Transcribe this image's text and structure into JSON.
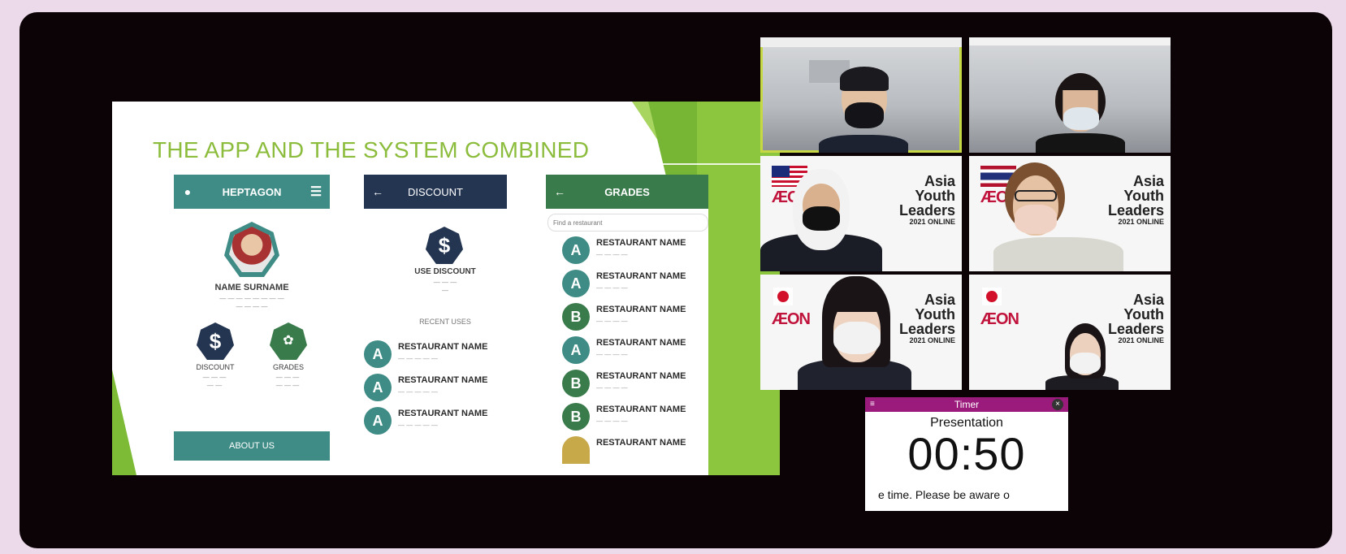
{
  "slide": {
    "title": "THE APP AND THE SYSTEM COMBINED",
    "col1": {
      "header": "HEPTAGON",
      "profile_name": "NAME SURNAME",
      "tile_discount": "DISCOUNT",
      "tile_grades": "GRADES",
      "about_button": "ABOUT US"
    },
    "col2": {
      "header": "DISCOUNT",
      "use_discount": "USE DISCOUNT",
      "recent_uses": "RECENT USES",
      "rows": [
        {
          "grade": "A",
          "name": "RESTAURANT NAME"
        },
        {
          "grade": "A",
          "name": "RESTAURANT NAME"
        },
        {
          "grade": "A",
          "name": "RESTAURANT NAME"
        }
      ]
    },
    "col3": {
      "header": "GRADES",
      "search_placeholder": "Find a restaurant",
      "rows": [
        {
          "grade": "A",
          "name": "RESTAURANT NAME"
        },
        {
          "grade": "A",
          "name": "RESTAURANT NAME"
        },
        {
          "grade": "B",
          "name": "RESTAURANT NAME"
        },
        {
          "grade": "A",
          "name": "RESTAURANT NAME"
        },
        {
          "grade": "B",
          "name": "RESTAURANT NAME"
        },
        {
          "grade": "B",
          "name": "RESTAURANT NAME"
        },
        {
          "grade": "",
          "name": "RESTAURANT NAME"
        }
      ]
    }
  },
  "branding": {
    "event_line1": "Asia",
    "event_line2": "Youth",
    "event_line3": "Leaders",
    "event_year": "2021 ONLINE",
    "sponsor": "ÆON"
  },
  "timer": {
    "title": "Timer",
    "label": "Presentation",
    "time": "00:50",
    "message": "e time.   Please be aware o"
  },
  "colors": {
    "accent_green": "#8cbc3c",
    "teal": "#3f8c86",
    "navy": "#243552",
    "grade_green": "#3a7b4b",
    "timer_bar": "#9b1b7c",
    "active_speaker_outline": "#c6d843"
  }
}
